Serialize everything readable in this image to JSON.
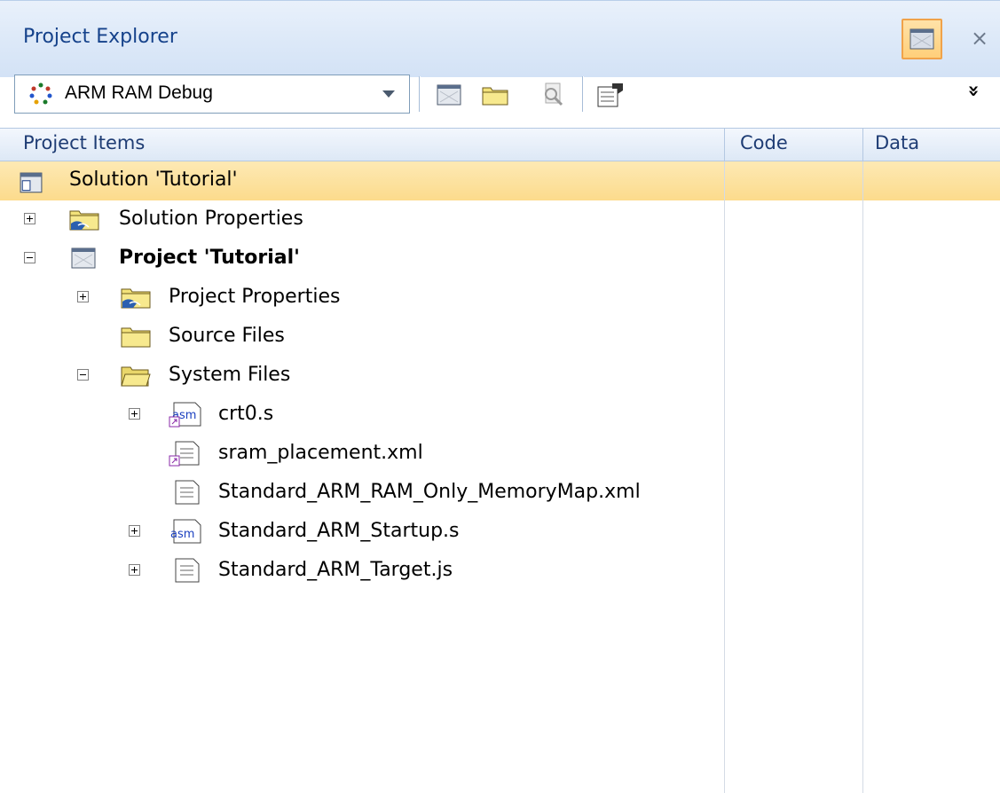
{
  "panel": {
    "title": "Project Explorer",
    "close_glyph": "×"
  },
  "toolbar": {
    "config_value": "ARM RAM Debug",
    "overflow_glyph": "»",
    "buttons": [
      "new-project-icon",
      "new-folder-icon",
      "find-icon",
      "properties-icon"
    ]
  },
  "columns": {
    "items": "Project Items",
    "code": "Code",
    "data": "Data"
  },
  "tree": [
    {
      "label": "Solution 'Tutorial'",
      "icon": "solution-icon",
      "selected": true
    },
    {
      "label": "Solution Properties",
      "icon": "properties-folder-icon",
      "expander": "plus"
    },
    {
      "label": "Project 'Tutorial'",
      "icon": "project-icon",
      "expander": "minus",
      "bold": true
    },
    {
      "label": "Project Properties",
      "icon": "properties-folder-icon",
      "expander": "plus"
    },
    {
      "label": "Source Files",
      "icon": "folder-icon"
    },
    {
      "label": "System Files",
      "icon": "folder-open-icon",
      "expander": "minus"
    },
    {
      "label": "crt0.s",
      "icon": "asm-link-file-icon",
      "expander": "plus"
    },
    {
      "label": "sram_placement.xml",
      "icon": "link-file-icon"
    },
    {
      "label": "Standard_ARM_RAM_Only_MemoryMap.xml",
      "icon": "text-file-icon"
    },
    {
      "label": "Standard_ARM_Startup.s",
      "icon": "asm-file-icon",
      "expander": "plus"
    },
    {
      "label": "Standard_ARM_Target.js",
      "icon": "text-file-icon",
      "expander": "plus"
    }
  ],
  "icon_text": {
    "asm": "asm"
  },
  "colors": {
    "title_text": "#15428b",
    "selection": "#fcdb8c",
    "highlight_border": "#f0a24a"
  }
}
